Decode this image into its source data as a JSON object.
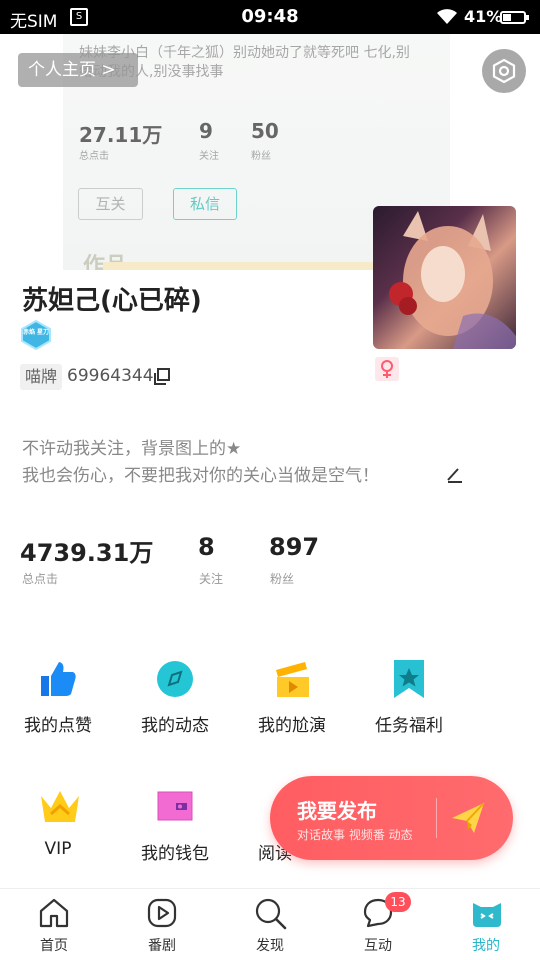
{
  "status_bar": {
    "sim": "无SIM",
    "time": "09:48",
    "battery_pct": "41%",
    "battery_level": 0.41
  },
  "header": {
    "personal_page_label": "个人主页 >",
    "settings_icon": "hexagon-settings-icon"
  },
  "background_image": {
    "text": "妹妹李小白（千年之狐）别动她动了就等死吧 七化,别给动我的人,别没事找事",
    "stats": [
      {
        "value": "27.11万",
        "label": "总点击"
      },
      {
        "value": "9",
        "label": "关注"
      },
      {
        "value": "50",
        "label": "粉丝"
      }
    ],
    "btn_mutual": "互关",
    "btn_message": "私信",
    "works_label": "作品"
  },
  "profile": {
    "name": "苏妲己(心已碎)",
    "level_badge": "赤焰 星刀",
    "tag": "喵牌",
    "uid": "69964344",
    "gender": "female",
    "bio_line1": "不许动我关注，背景图上的★",
    "bio_line2": "我也会伤心，不要把我对你的关心当做是空气！"
  },
  "stats": [
    {
      "value": "4739.31万",
      "label": "总点击"
    },
    {
      "value": "8",
      "label": "关注"
    },
    {
      "value": "897",
      "label": "粉丝"
    }
  ],
  "menu": [
    {
      "label": "我的点赞",
      "icon": "thumbs-up-icon"
    },
    {
      "label": "我的动态",
      "icon": "compass-icon"
    },
    {
      "label": "我的尬演",
      "icon": "clapperboard-icon"
    },
    {
      "label": "任务福利",
      "icon": "star-bookmark-icon"
    },
    {
      "label": "VIP",
      "icon": "crown-icon"
    },
    {
      "label": "我的钱包",
      "icon": "wallet-icon"
    },
    {
      "label": "阅读",
      "icon": "book-icon"
    }
  ],
  "publish": {
    "title": "我要发布",
    "subtitle": "对话故事 视频番 动态"
  },
  "bottom_nav": [
    {
      "label": "首页",
      "icon": "home-icon"
    },
    {
      "label": "番剧",
      "icon": "play-icon"
    },
    {
      "label": "发现",
      "icon": "search-icon"
    },
    {
      "label": "互动",
      "icon": "chat-icon",
      "badge": "13"
    },
    {
      "label": "我的",
      "icon": "cat-face-icon",
      "active": true
    }
  ],
  "colors": {
    "accent": "#27b6c9",
    "publish": "#ff5d61",
    "badge": "#ff4f5a"
  }
}
